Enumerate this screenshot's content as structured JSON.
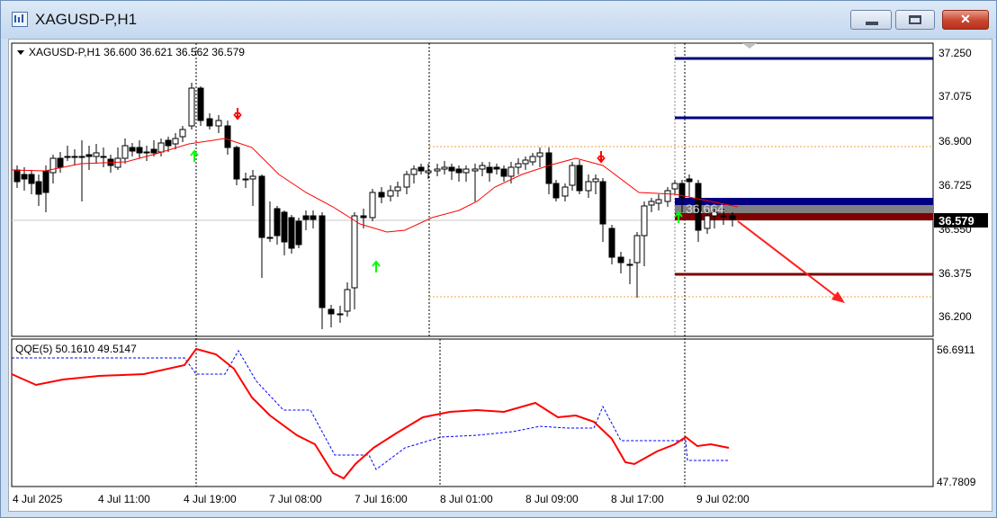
{
  "window": {
    "title": "XAGUSD-P,H1",
    "close_label": "✕"
  },
  "chart": {
    "header": "XAGUSD-P,H1  36.600 36.621 36.562 36.579",
    "current_price": "36.579",
    "overlay_price": "36.664",
    "price_ticks": [
      "37.250",
      "37.075",
      "36.900",
      "36.725",
      "36.550",
      "36.375",
      "36.200"
    ],
    "time_labels": [
      "4 Jul 2025",
      "4 Jul 11:00",
      "4 Jul 19:00",
      "7 Jul 08:00",
      "7 Jul 16:00",
      "8 Jul 01:00",
      "8 Jul 09:00",
      "8 Jul 17:00",
      "9 Jul 02:00"
    ],
    "colors": {
      "bull_candle": "#ffffff",
      "bear_candle": "#000000",
      "ma_line": "#ff0000",
      "level_blue": "#000080",
      "level_darkred": "#800000",
      "arrow_down": "#ff0000",
      "arrow_up": "#00ff00",
      "projection_arrow": "#ff2020"
    }
  },
  "indicator": {
    "header": "QQE(5) 50.1610 49.5147",
    "max_label": "56.6911",
    "min_label": "47.7809",
    "colors": {
      "main": "#ff0000",
      "signal": "#0000ff"
    }
  }
}
